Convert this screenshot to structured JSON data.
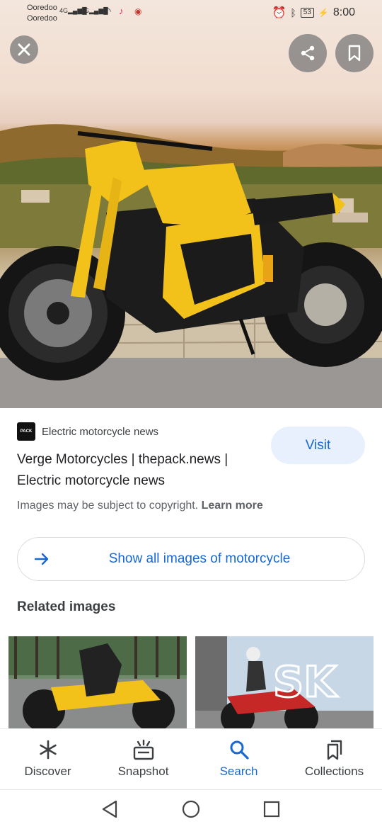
{
  "status_bar": {
    "carrier_1": "Ooredoo",
    "carrier_2": "Ooredoo",
    "signal_1_type": "4G",
    "signal_2_type": "3G",
    "battery": "53",
    "time": "8:00"
  },
  "hero": {
    "close_icon": "close-icon",
    "share_icon": "share-icon",
    "bookmark_icon": "bookmark-icon"
  },
  "result": {
    "source_name": "Electric motorcycle news",
    "source_logo_text": "PACK",
    "title": "Verge Motorcycles | thepack.news | Electric motorcycle news",
    "visit_label": "Visit",
    "copyright_text": "Images may be subject to copyright.",
    "learn_more": "Learn more",
    "show_all_label": "Show all images of motorcycle"
  },
  "related": {
    "heading": "Related images",
    "watermark_text": "SK"
  },
  "bottom_nav": {
    "items": [
      {
        "label": "Discover",
        "icon": "asterisk-icon"
      },
      {
        "label": "Snapshot",
        "icon": "snapshot-icon"
      },
      {
        "label": "Search",
        "icon": "search-icon",
        "active": true
      },
      {
        "label": "Collections",
        "icon": "collections-icon"
      }
    ]
  },
  "colors": {
    "accent_blue": "#1967d2",
    "visit_bg": "#e8f0fe",
    "bike_yellow": "#f2c21a"
  }
}
